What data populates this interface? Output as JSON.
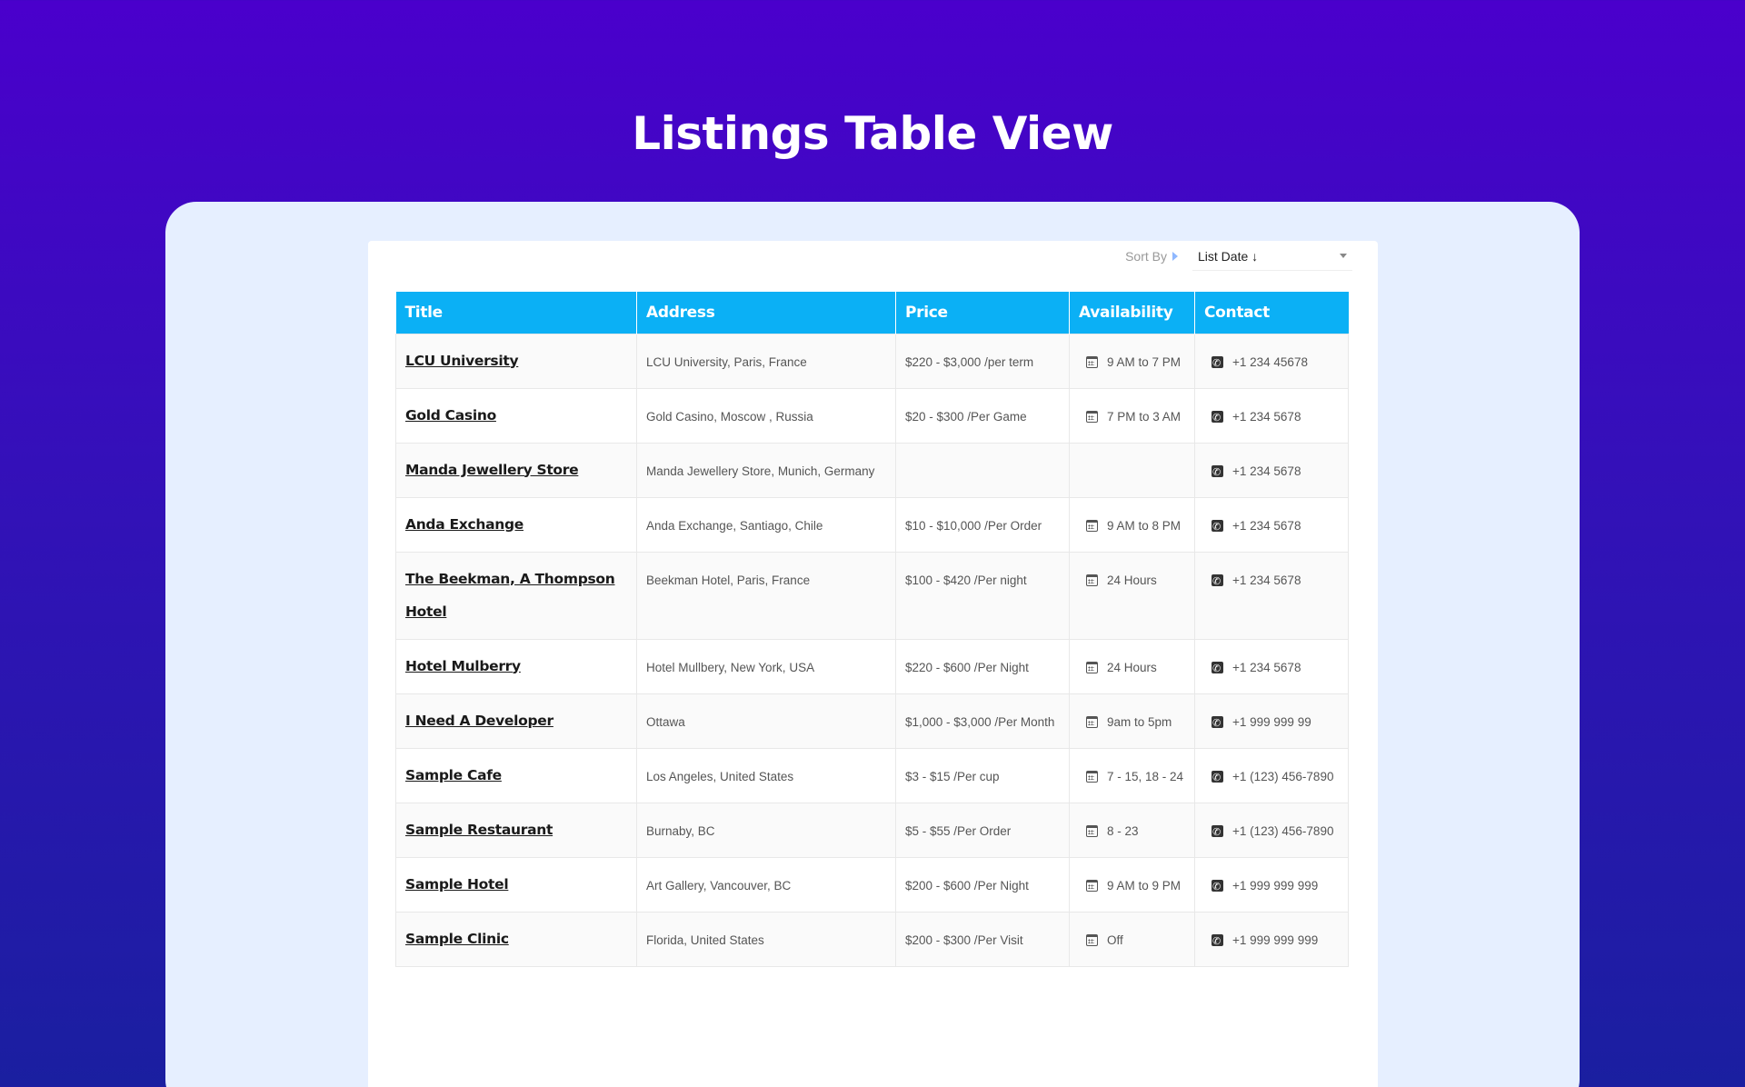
{
  "page": {
    "title": "Listings Table View"
  },
  "sort": {
    "label": "Sort By",
    "value": "List Date ↓"
  },
  "table": {
    "headers": [
      "Title",
      "Address",
      "Price",
      "Availability",
      "Contact"
    ],
    "rows": [
      {
        "title": "LCU University",
        "address": "LCU University, Paris, France",
        "price": "$220 - $3,000 /per term",
        "availability": "9 AM to 7 PM",
        "contact": "+1 234 45678"
      },
      {
        "title": "Gold Casino",
        "address": "Gold Casino, Moscow , Russia",
        "price": "$20 - $300 /Per Game",
        "availability": "7 PM to 3 AM",
        "contact": "+1 234 5678"
      },
      {
        "title": "Manda Jewellery Store",
        "address": "Manda Jewellery Store, Munich, Germany",
        "price": "",
        "availability": "",
        "contact": "+1 234 5678"
      },
      {
        "title": "Anda Exchange",
        "address": "Anda Exchange, Santiago, Chile",
        "price": "$10 - $10,000 /Per Order",
        "availability": "9 AM to 8 PM",
        "contact": "+1 234 5678"
      },
      {
        "title": "The Beekman, A Thompson Hotel",
        "address": "Beekman Hotel, Paris, France",
        "price": "$100 - $420 /Per night",
        "availability": "24 Hours",
        "contact": "+1 234 5678"
      },
      {
        "title": "Hotel Mulberry",
        "address": "Hotel Mullbery, New York, USA",
        "price": "$220 - $600 /Per Night",
        "availability": "24 Hours",
        "contact": "+1 234 5678"
      },
      {
        "title": "I Need A Developer",
        "address": "Ottawa",
        "price": "$1,000 - $3,000 /Per Month",
        "availability": "9am to 5pm",
        "contact": "+1 999 999 99"
      },
      {
        "title": "Sample Cafe",
        "address": "Los Angeles, United States",
        "price": "$3 - $15 /Per cup",
        "availability": "7 - 15, 18 - 24",
        "contact": "+1 (123) 456-7890"
      },
      {
        "title": "Sample Restaurant",
        "address": "Burnaby, BC",
        "price": "$5 - $55 /Per Order",
        "availability": "8 - 23",
        "contact": "+1 (123) 456-7890"
      },
      {
        "title": "Sample Hotel",
        "address": "Art Gallery, Vancouver, BC",
        "price": "$200 - $600 /Per Night",
        "availability": "9 AM to 9 PM",
        "contact": "+1 999 999 999"
      },
      {
        "title": "Sample Clinic",
        "address": "Florida, United States",
        "price": "$200 - $300 /Per Visit",
        "availability": "Off",
        "contact": "+1 999 999 999"
      }
    ]
  },
  "icons": {
    "availability": "calendar-icon",
    "contact": "phone-icon",
    "sort": "caret-right-icon",
    "select": "chevron-down-icon"
  },
  "colors": {
    "header": "#0bb0f5",
    "background_top": "#4a00cc",
    "card": "#e6efff"
  }
}
